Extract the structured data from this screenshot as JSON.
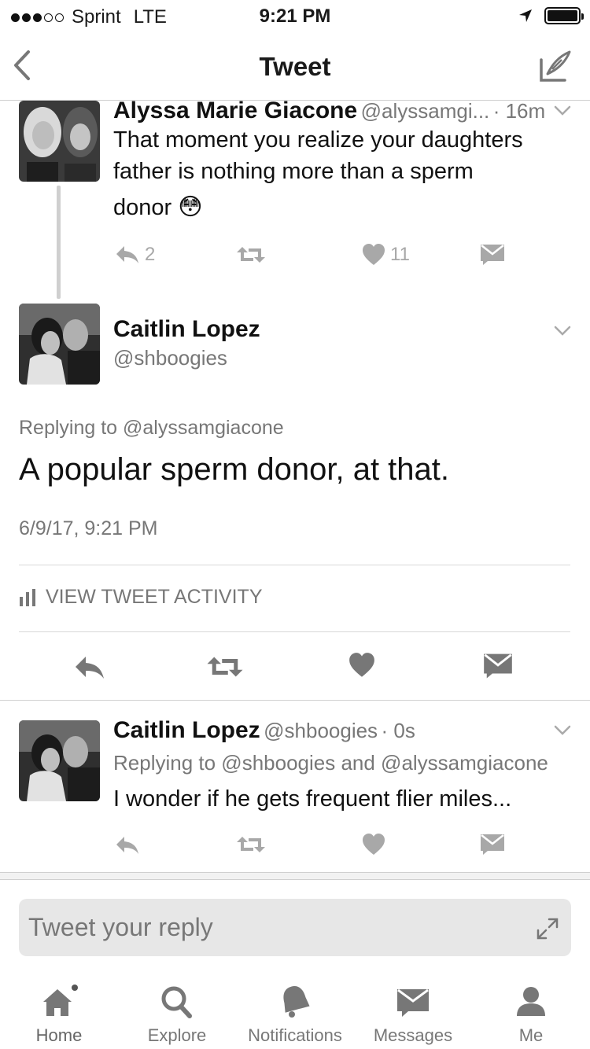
{
  "status_bar": {
    "carrier": "Sprint",
    "network": "LTE",
    "time": "9:21 PM"
  },
  "nav": {
    "title": "Tweet"
  },
  "parent_tweet": {
    "name": "Alyssa Marie Giacone",
    "handle": "@alyssamgi...",
    "meta": "· 16m",
    "text_line1": "That moment you realize your daughters",
    "text_line2": "father is nothing more than a sperm",
    "text_line3": "donor",
    "emoji": "😳",
    "reply_count": "2",
    "like_count": "11"
  },
  "main_tweet": {
    "name": "Caitlin Lopez",
    "handle": "@shboogies",
    "replying_to": "Replying to @alyssamgiacone",
    "text": "A popular sperm donor, at that.",
    "timestamp": "6/9/17, 9:21 PM",
    "activity_label": "VIEW TWEET ACTIVITY"
  },
  "reply_tweet": {
    "name": "Caitlin Lopez",
    "handle": "@shboogies",
    "meta": "· 0s",
    "replying_to": "Replying to @shboogies and @alyssamgiacone",
    "text": "I wonder if he gets frequent flier miles..."
  },
  "reply_box": {
    "placeholder": "Tweet your reply"
  },
  "tabs": [
    {
      "label": "Home",
      "icon": "home-icon"
    },
    {
      "label": "Explore",
      "icon": "search-icon"
    },
    {
      "label": "Notifications",
      "icon": "bell-icon"
    },
    {
      "label": "Messages",
      "icon": "envelope-icon"
    },
    {
      "label": "Me",
      "icon": "person-icon"
    }
  ]
}
